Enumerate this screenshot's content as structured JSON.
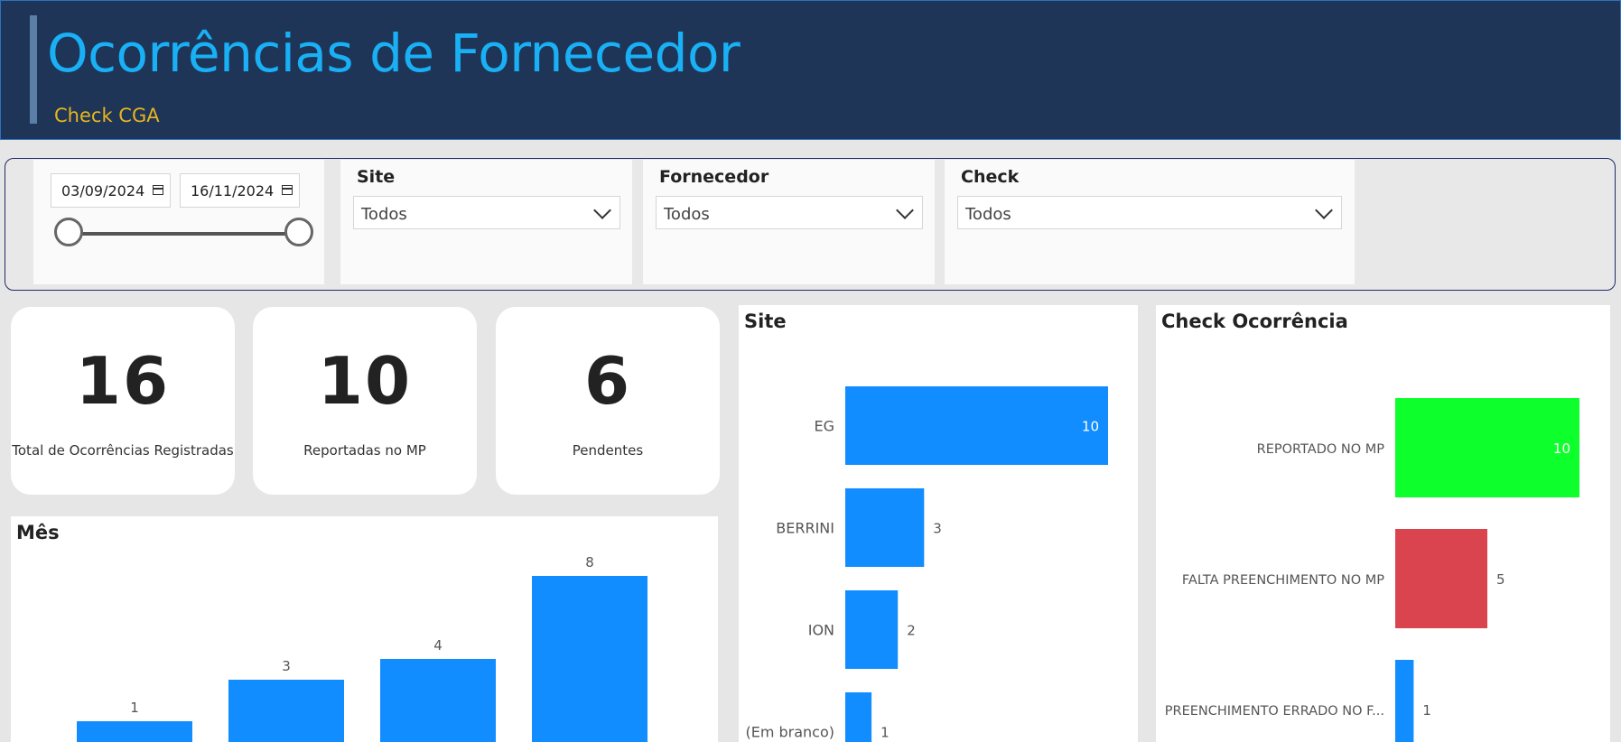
{
  "header": {
    "title": "Ocorrências de Fornecedor",
    "subtitle": "Check CGA"
  },
  "filters": {
    "date_start": "03/09/2024",
    "date_end": "16/11/2024",
    "site": {
      "title": "Site",
      "value": "Todos"
    },
    "fornecedor": {
      "title": "Fornecedor",
      "value": "Todos"
    },
    "check": {
      "title": "Check",
      "value": "Todos"
    }
  },
  "kpis": [
    {
      "value": "16",
      "label": "Total de Ocorrências Registradas"
    },
    {
      "value": "10",
      "label": "Reportadas no MP"
    },
    {
      "value": "6",
      "label": "Pendentes"
    }
  ],
  "colors": {
    "header_bg": "#1e3557",
    "title": "#19b0f5",
    "subtitle": "#e8b51c",
    "bar_blue": "#118dff",
    "bar_green": "#0dff2c",
    "bar_red": "#d9444f"
  },
  "chart_data": [
    {
      "type": "bar",
      "title": "Mês",
      "categories": [],
      "values": [
        1,
        3,
        4,
        8
      ]
    },
    {
      "type": "bar",
      "orientation": "horizontal",
      "title": "Site",
      "categories": [
        "EG",
        "BERRINI",
        "ION",
        "(Em branco)"
      ],
      "values": [
        10,
        3,
        2,
        1
      ]
    },
    {
      "type": "bar",
      "orientation": "horizontal",
      "title": "Check Ocorrência",
      "categories": [
        "REPORTADO NO MP",
        "FALTA PREENCHIMENTO NO MP",
        "PREENCHIMENTO ERRADO NO F..."
      ],
      "values": [
        10,
        5,
        1
      ],
      "colors": [
        "#0dff2c",
        "#d9444f",
        "#118dff"
      ]
    }
  ]
}
